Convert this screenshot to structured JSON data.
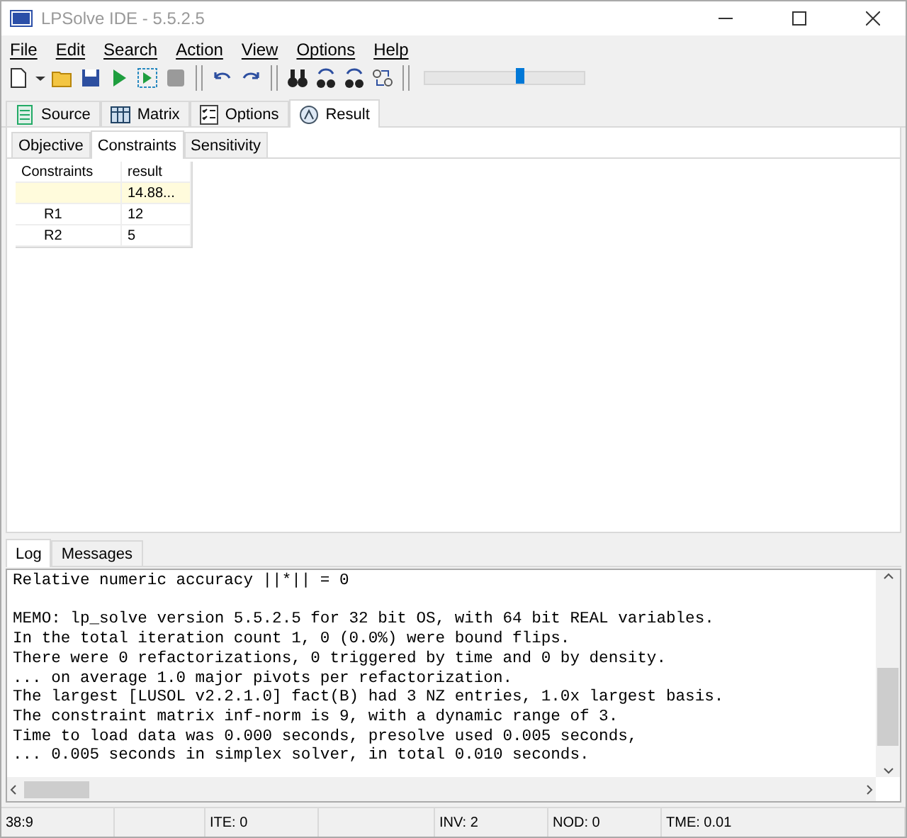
{
  "window": {
    "title": "LPSolve IDE - 5.5.2.5"
  },
  "menu": [
    "File",
    "Edit",
    "Search",
    "Action",
    "View",
    "Options",
    "Help"
  ],
  "toolbar": {
    "slider": {
      "level": 0.6
    }
  },
  "tabs": [
    {
      "label": "Source",
      "selected": false
    },
    {
      "label": "Matrix",
      "selected": false
    },
    {
      "label": "Options",
      "selected": false
    },
    {
      "label": "Result",
      "selected": true
    }
  ],
  "subtabs": [
    {
      "label": "Objective",
      "selected": false
    },
    {
      "label": "Constraints",
      "selected": true
    },
    {
      "label": "Sensitivity",
      "selected": false
    }
  ],
  "table": {
    "columns": [
      "Constraints",
      "result"
    ],
    "rows": [
      {
        "result": "14.88...",
        "highlighted": true
      },
      {
        "name": "R1",
        "result": "12",
        "highlighted": false
      },
      {
        "name": "R2",
        "result": "5",
        "highlighted": false
      }
    ]
  },
  "log_tabs": [
    {
      "label": "Log",
      "selected": true
    },
    {
      "label": "Messages",
      "selected": false
    }
  ],
  "log": [
    {
      "text": "Relative numeric accuracy ||*|| = 0",
      "gap_before": false
    },
    {
      "text": "MEMO: lp_solve version 5.5.2.5 for 32 bit OS, with 64 bit REAL variables.",
      "gap_before": true
    },
    {
      "text": "In the total iteration count 1, 0 (0.0%) were bound flips.",
      "gap_before": false
    },
    {
      "text": "There were 0 refactorizations, 0 triggered by time and 0 by density.",
      "gap_before": false
    },
    {
      "text": "... on average 1.0 major pivots per refactorization.",
      "gap_before": false
    },
    {
      "text": "The largest [LUSOL v2.2.1.0] fact(B) had 3 NZ entries, 1.0x largest basis.",
      "gap_before": false
    },
    {
      "text": "The constraint matrix inf-norm is 9, with a dynamic range of 3.",
      "gap_before": false
    },
    {
      "text": "Time to load data was 0.000 seconds, presolve used 0.005 seconds,",
      "gap_before": false
    },
    {
      "text": "... 0.005 seconds in simplex solver, in total 0.010 seconds.",
      "gap_before": false
    }
  ],
  "status_bar": [
    {
      "kind": "text",
      "text": "38:9"
    },
    {
      "kind": "spacer"
    },
    {
      "kind": "text",
      "text": "ITE: 0"
    },
    {
      "kind": "spacer"
    },
    {
      "kind": "text",
      "text": "INV: 2"
    },
    {
      "kind": "text",
      "text": "NOD: 0"
    },
    {
      "kind": "text",
      "text": "TME: 0.01"
    }
  ]
}
